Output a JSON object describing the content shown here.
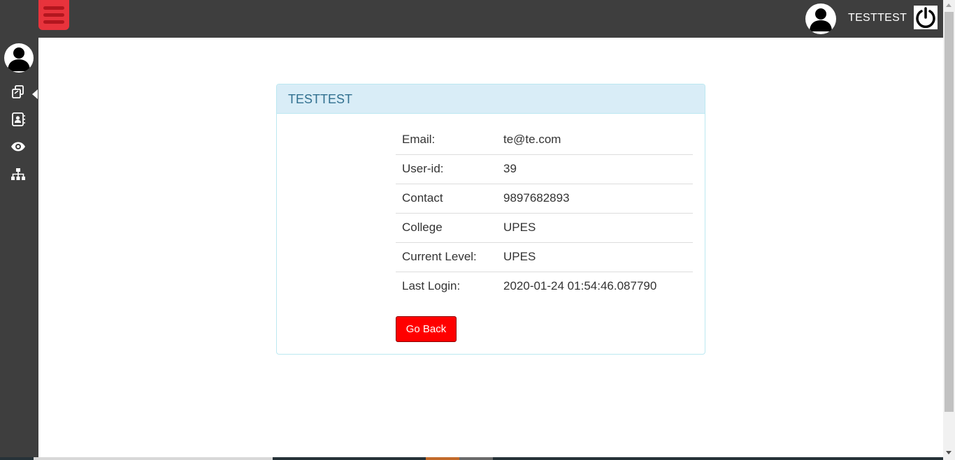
{
  "header": {
    "username": "TESTTEST",
    "menu_icon": "hamburger-menu-icon",
    "avatar_icon": "user-avatar-icon",
    "logout_icon": "power-icon"
  },
  "sidebar": {
    "items": [
      {
        "icon": "copy-icon"
      },
      {
        "icon": "contact-card-icon"
      },
      {
        "icon": "eye-icon"
      },
      {
        "icon": "sitemap-icon"
      }
    ]
  },
  "panel": {
    "title": "TESTTEST",
    "rows": [
      {
        "label": "Email:",
        "value": "te@te.com"
      },
      {
        "label": "User-id:",
        "value": "39"
      },
      {
        "label": "Contact",
        "value": "9897682893"
      },
      {
        "label": "College",
        "value": "UPES"
      },
      {
        "label": "Current Level:",
        "value": "UPES"
      },
      {
        "label": "Last Login:",
        "value": "2020-01-24 01:54:46.087790"
      }
    ],
    "button_label": "Go Back"
  },
  "colors": {
    "topbar": "#3e3e3e",
    "menu_button": "#e8333c",
    "panel_heading": "#d9edf7",
    "panel_title": "#31708f",
    "go_back_button": "#ff0000"
  }
}
